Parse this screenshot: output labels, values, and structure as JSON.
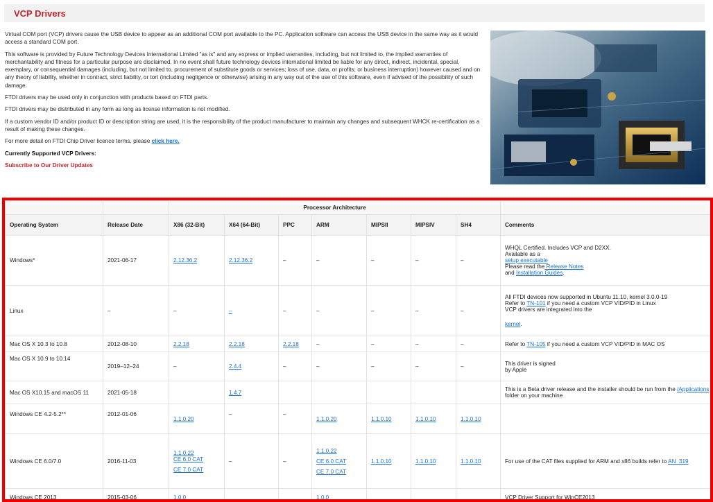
{
  "page": {
    "title": "VCP Drivers",
    "intro": {
      "p1": "Virtual COM port (VCP) drivers cause the USB device to appear as an additional COM port available to the PC. Application software can access the USB device in the same way as it would access a standard COM port.",
      "p2": "This software is provided by Future Technology Devices International Limited \"as is\" and any express or implied warranties, including, but not limited to, the implied warranties of merchantability and fitness for a particular purpose are disclaimed. In no event shall future technology devices international limited be liable for any direct, indirect, incidental, special, exemplary, or consequential damages (including, but not limited to, procurement of substitute goods or services; loss of use, data, or profits; or business interruption) however caused and on any theory of liability, whether in contract, strict liability, or tort (including negligence or otherwise) arising in any way out of the use of this software, even if advised of the possibility of such damage.",
      "p3": "FTDI drivers may be used only in conjunction with products based on FTDI parts.",
      "p4": "FTDI drivers may be distributed in any form as long as license information is not modified.",
      "p5": "If a custom vendor ID and/or product ID or description string are used, it is the responsibility of the product manufacturer to maintain any changes and subsequent WHCK re-certification as a result of making these changes.",
      "p6_prefix": "For more detail on FTDI Chip Driver licence terms, please ",
      "p6_link": "click here.",
      "currently_supported": "Currently Supported VCP Drivers:",
      "subscribe": "Subscribe to Our Driver Updates"
    },
    "photo_icon": "circuit-board-photo"
  },
  "table": {
    "group_header": "Processor Architecture",
    "headers": {
      "os": "Operating System",
      "release": "Release Date",
      "x86": "X86 (32-Bit)",
      "x64": "X64 (64-Bit)",
      "ppc": "PPC",
      "arm": "ARM",
      "mipsii": "MIPSII",
      "mipsiv": "MIPSIV",
      "sh4": "SH4",
      "comments": "Comments"
    },
    "rows": {
      "windows": {
        "os": "Windows*",
        "release": "2021-06-17",
        "x86": "2.12.36.2",
        "x64": "2.12.36.2",
        "ppc": "–",
        "arm": "–",
        "mipsii": "–",
        "mipsiv": "–",
        "sh4": "–",
        "c1": "WHQL Certified. Includes VCP and D2XX.",
        "c2": "Available as a",
        "c3": "setup executable",
        "c4": "Please read the",
        "c5": " Release Notes",
        "c6": "and ",
        "c7": "Installation Guides",
        "c8": "."
      },
      "linux": {
        "os": "Linux",
        "release": "–",
        "x86": "–",
        "x64": "–",
        "ppc": "–",
        "arm": "–",
        "mipsii": "–",
        "mipsiv": "–",
        "sh4": "–",
        "c1": "All FTDI devices now supported in Ubuntu 11.10, kernel 3.0.0-19",
        "c2": "Refer to ",
        "c3": "TN-101",
        "c4": " if you need a custom VCP VID/PID in Linux",
        "c5": "VCP drivers are integrated into the",
        "c6": "kernel",
        "c7": "."
      },
      "mac1": {
        "os": "Mac OS X 10.3 to 10.8",
        "release": "2012-08-10",
        "x86": "2.2.18",
        "x64": "2.2.18",
        "ppc": "2.2.18",
        "arm": "–",
        "mipsii": "–",
        "mipsiv": "–",
        "sh4": "–",
        "c1": "Refer to ",
        "c2": "TN-105",
        "c3": " if you need a custom VCP VID/PID in MAC OS"
      },
      "mac2": {
        "os": "Mac OS X 10.9 to 10.14",
        "release": "2019–12–24",
        "x86": "–",
        "x64": "2.4.4",
        "ppc": "–",
        "arm": "–",
        "mipsii": "–",
        "mipsiv": "–",
        "sh4": "–",
        "c1": "This driver is signed",
        "c2": "by Apple"
      },
      "mac3": {
        "os": "Mac OS X10.15 and macOS 11",
        "release": "2021-05-18",
        "x64": "1.4.7",
        "c1": "This is a Beta driver release and the installer should be run from the ",
        "c2": "/Applications",
        "c3": "folder on your machine"
      },
      "wince42": {
        "os": "Windows CE 4.2-5.2**",
        "release": "2012-01-06",
        "x86": "1.1.0.20",
        "x64": "–",
        "ppc": "–",
        "arm": "1.1.0.20",
        "mipsii": "1.1.0.10",
        "mipsiv": "1.1.0.10",
        "sh4": "1.1.0.10"
      },
      "wince60": {
        "os": "Windows CE 6.0/7.0",
        "release": "2016-11-03",
        "x86a": "1.1.0.22",
        "x86b": "CE 6.0 CAT",
        "x86c": "CE 7.0 CAT",
        "x64": "–",
        "ppc": "–",
        "arma": "1.1.0.22",
        "armb": "CE 6.0 CAT",
        "armc": "CE 7.0 CAT",
        "mipsii": "1.1.0.10",
        "mipsiv": "1.1.0.10",
        "sh4": "1.1.0.10",
        "c1": "For use of the CAT files supplied for ARM and x86 builds refer to ",
        "c2": "AN_319"
      },
      "wince2013": {
        "os": "Windows CE 2013",
        "release": "2015-03-06",
        "x86": "1.0.0",
        "arm": "1.0.0",
        "c1": "VCP Driver Support for WinCE2013"
      }
    }
  }
}
